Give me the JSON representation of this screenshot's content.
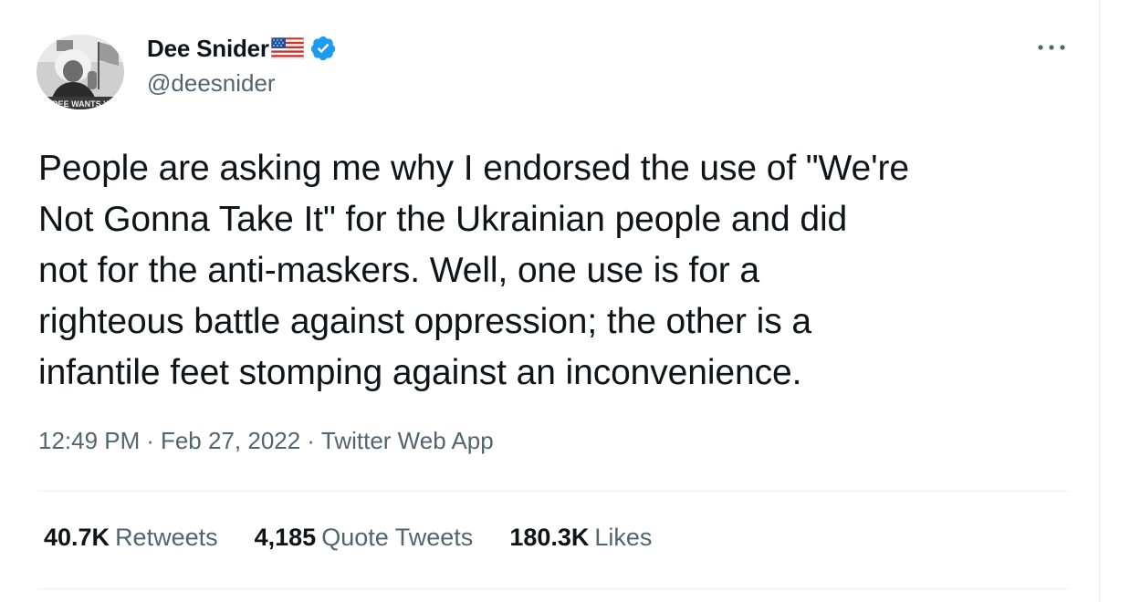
{
  "tweet": {
    "author": {
      "display_name": "Dee Snider",
      "handle": "@deesnider",
      "verified": true,
      "flag_emoji": "us-flag-icon",
      "avatar_caption": "DEE WANTS Y"
    },
    "text": "People are asking me why I endorsed the use of \"We're\nNot Gonna Take It\" for the Ukrainian people and did\nnot for the anti-maskers. Well, one use is for a\nrighteous battle against oppression; the other is a\ninfantile feet stomping against an inconvenience.",
    "time": "12:49 PM",
    "date": "Feb 27, 2022",
    "separator": "·",
    "source": "Twitter Web App"
  },
  "stats": {
    "retweets": {
      "value": "40.7K",
      "label": "Retweets"
    },
    "quote_tweets": {
      "value": "4,185",
      "label": "Quote Tweets"
    },
    "likes": {
      "value": "180.3K",
      "label": "Likes"
    }
  },
  "colors": {
    "text_primary": "#0f1419",
    "text_secondary": "#536471",
    "verified_blue": "#1d9bf0",
    "divider": "#eff3f4"
  }
}
